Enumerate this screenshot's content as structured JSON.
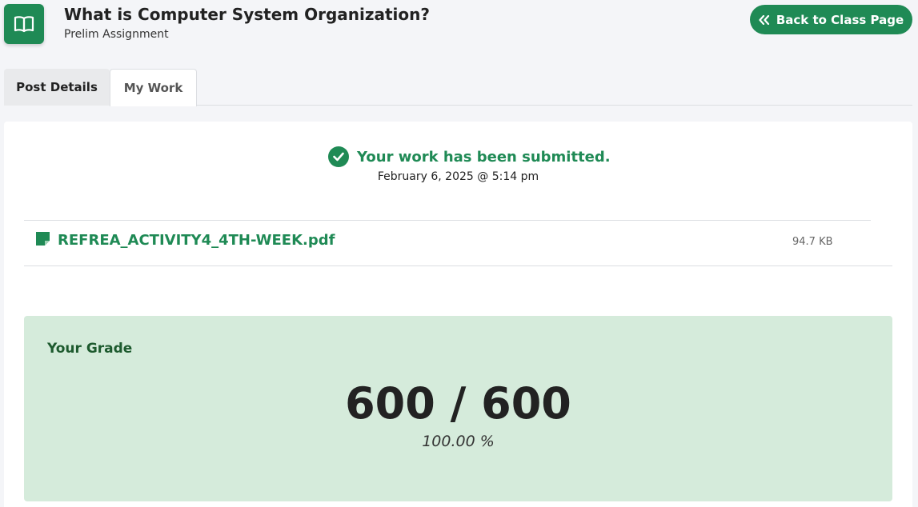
{
  "header": {
    "title": "What is Computer System Organization?",
    "subtitle": "Prelim Assignment",
    "icon": "open-book-icon",
    "back_button_label": "Back to Class Page",
    "back_button_icon": "double-chevron-left-icon"
  },
  "tabs": [
    {
      "label": "Post Details",
      "active": false
    },
    {
      "label": "My Work",
      "active": true
    }
  ],
  "submission": {
    "status_text": "Your work has been submitted.",
    "status_icon": "check-circle-icon",
    "date": "February 6, 2025 @ 5:14 pm"
  },
  "file": {
    "name": "REFREA_ACTIVITY4_4TH-WEEK.pdf",
    "size": "94.7 KB",
    "icon": "file-icon"
  },
  "grade": {
    "label": "Your Grade",
    "score": "600 / 600",
    "percent": "100.00 %"
  },
  "colors": {
    "accent": "#1f8a55",
    "grade_background": "#d5ebdb",
    "page_background": "#f4f5f8"
  }
}
